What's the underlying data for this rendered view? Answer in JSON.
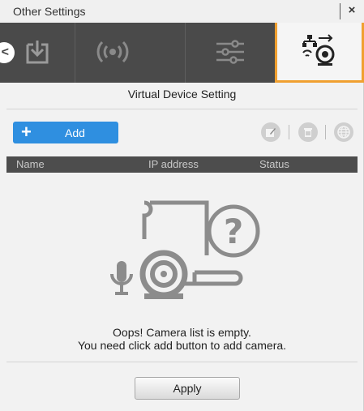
{
  "window": {
    "title": "Other Settings",
    "close_glyph": "×"
  },
  "tabs": [
    {
      "name": "download-icon",
      "active": false
    },
    {
      "name": "broadcast-icon",
      "active": false
    },
    {
      "name": "sliders-icon",
      "active": false
    },
    {
      "name": "network-camera-icon",
      "active": true
    }
  ],
  "back_glyph": "<",
  "section": {
    "title": "Virtual Device Setting"
  },
  "toolbar": {
    "add_label": "Add",
    "add_glyph": "+",
    "icons": [
      "edit-icon",
      "delete-icon",
      "globe-icon"
    ]
  },
  "table": {
    "columns": [
      "Name",
      "IP address",
      "Status"
    ],
    "rows": []
  },
  "empty_state": {
    "line1": "Oops! Camera list is empty.",
    "line2": "You need click add button to add camera."
  },
  "footer": {
    "apply_label": "Apply"
  },
  "colors": {
    "accent": "#2f8fe0",
    "active_tab_border": "#f0a030",
    "tabbar_bg": "#4a4a4a"
  }
}
